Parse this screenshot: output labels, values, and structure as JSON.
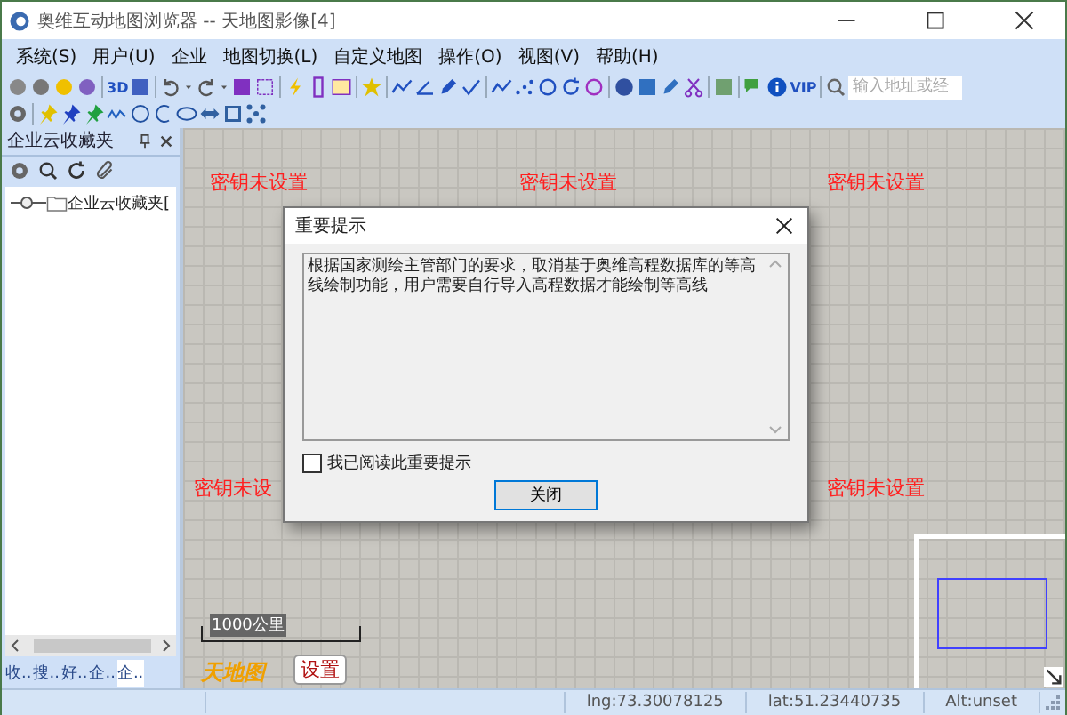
{
  "window": {
    "title": "奥维互动地图浏览器 -- 天地图影像[4]"
  },
  "menu": [
    "系统(S)",
    "用户(U)",
    "企业",
    "地图切换(L)",
    "自定义地图",
    "操作(O)",
    "视图(V)",
    "帮助(H)"
  ],
  "toolbar": {
    "text_buttons": [
      "3D",
      "VIP"
    ],
    "search": {
      "placeholder": "输入地址或经"
    }
  },
  "favorites_panel": {
    "title": "企业云收藏夹",
    "tree": [
      {
        "label": "企业云收藏夹["
      }
    ],
    "tabs": [
      {
        "label": "收..",
        "selected": false
      },
      {
        "label": "搜..",
        "selected": false
      },
      {
        "label": "好..",
        "selected": false
      },
      {
        "label": "企..",
        "selected": false
      },
      {
        "label": "企..",
        "selected": true
      }
    ]
  },
  "map": {
    "labels": [
      "密钥未设置",
      "密钥未设置",
      "密钥未设置",
      "密钥未设",
      "密钥未设置"
    ],
    "scale": "1000公里",
    "logo": "天地图",
    "settings_button": "设置"
  },
  "dialog": {
    "title": "重要提示",
    "message": "根据国家测绘主管部门的要求，取消基于奥维高程数据库的等高线绘制功能，用户需要自行导入高程数据才能绘制等高线",
    "checkbox": {
      "label": "我已阅读此重要提示",
      "checked": false
    },
    "button": "关闭"
  },
  "status_bar": [
    "lng:73.30078125",
    "lat:51.23440735",
    "Alt:unset"
  ]
}
